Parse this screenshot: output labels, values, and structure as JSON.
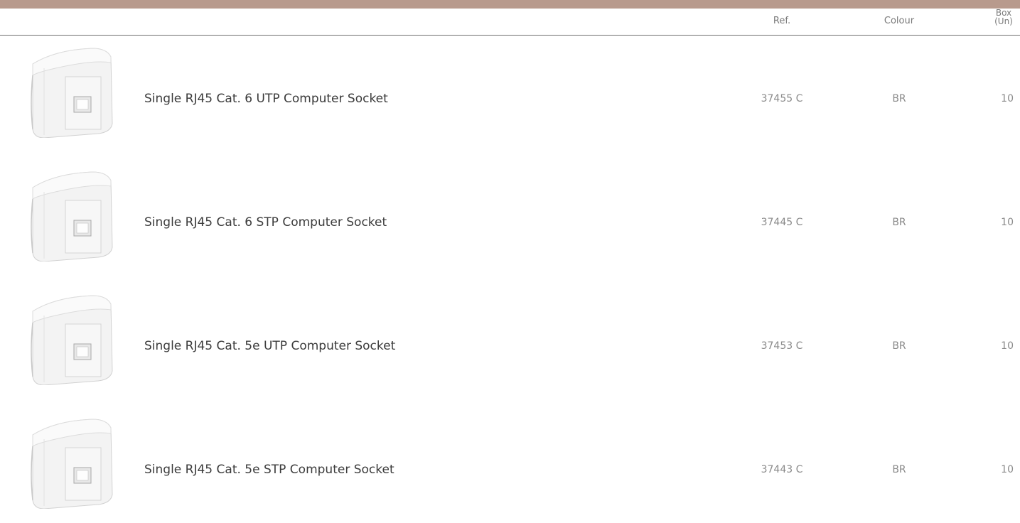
{
  "theme": {
    "accent": "#b89a8d"
  },
  "table": {
    "headers": {
      "ref": "Ref.",
      "colour": "Colour",
      "box_line1": "Box",
      "box_line2": "(Un)"
    },
    "rows": [
      {
        "description": "Single RJ45 Cat. 6 UTP Computer Socket",
        "ref": "37455 C",
        "colour": "BR",
        "qty": "10",
        "image": "rj45-socket-image"
      },
      {
        "description": "Single RJ45 Cat. 6 STP Computer Socket",
        "ref": "37445 C",
        "colour": "BR",
        "qty": "10",
        "image": "rj45-socket-image"
      },
      {
        "description": "Single RJ45 Cat. 5e UTP Computer Socket",
        "ref": "37453 C",
        "colour": "BR",
        "qty": "10",
        "image": "rj45-socket-image"
      },
      {
        "description": "Single RJ45 Cat. 5e STP Computer Socket",
        "ref": "37443 C",
        "colour": "BR",
        "qty": "10",
        "image": "rj45-socket-image"
      }
    ]
  }
}
